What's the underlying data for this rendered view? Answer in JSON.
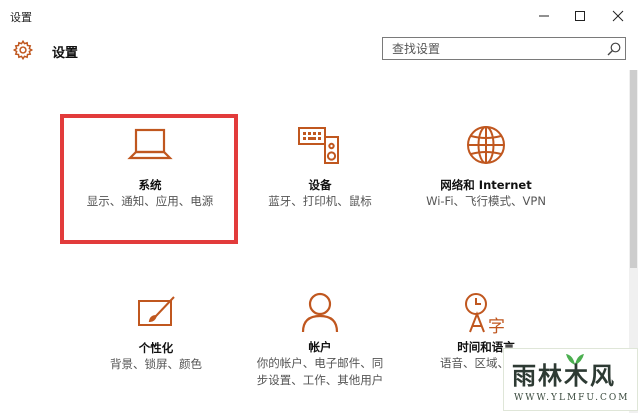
{
  "window": {
    "title": "设置"
  },
  "header": {
    "title": "设置"
  },
  "search": {
    "placeholder": "查找设置"
  },
  "tiles": [
    {
      "title": "系统",
      "desc": "显示、通知、应用、电源",
      "icon": "laptop-icon"
    },
    {
      "title": "设备",
      "desc": "蓝牙、打印机、鼠标",
      "icon": "devices-icon"
    },
    {
      "title": "网络和 Internet",
      "desc": "Wi-Fi、飞行模式、VPN",
      "icon": "globe-icon"
    },
    {
      "title": "个性化",
      "desc": "背景、锁屏、颜色",
      "icon": "personalization-icon"
    },
    {
      "title": "帐户",
      "desc": "你的帐户、电子邮件、同步设置、工作、其他用户",
      "icon": "person-icon"
    },
    {
      "title": "时间和语言",
      "desc": "语音、区域、日期",
      "icon": "time-language-icon"
    }
  ],
  "watermark": {
    "text": "雨林木风",
    "url": "WWW.YLMFU.COM"
  },
  "colors": {
    "accent": "#c0571f",
    "highlight": "#e23b3b"
  }
}
